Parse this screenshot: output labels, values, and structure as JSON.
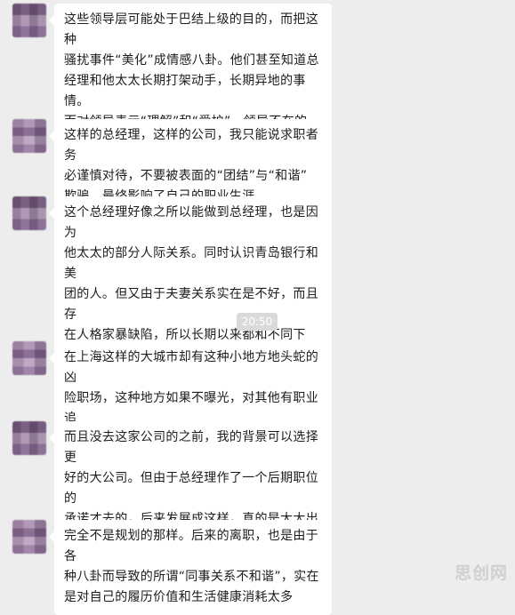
{
  "messages": [
    {
      "avatar_icon": "blurred-avatar-icon",
      "text": "这些领导层可能处于巴结上级的目的，而把这种\n骚扰事件“美化”成情感八卦。他们甚至知道总\n经理和他太太长期打架动手，长期异地的事情。\n而对领导表示“理解”和“爱护”。领导不在的\n时候就是八卦和小鞋的模样了"
    },
    {
      "avatar_icon": "blurred-avatar-icon",
      "text": "这样的总经理，这样的公司，我只能说求职者务\n必谨慎对待，不要被表面的“团结”与“和谐”\n欺骗，最终影响了自己的职业生涯。"
    },
    {
      "avatar_icon": "blurred-avatar-icon",
      "text": "这个总经理好像之所以能做到总经理，也是因为\n他太太的部分人际关系。同时认识青岛银行和美\n团的人。但又由于夫妻关系实在是不好，而且存\n在人格家暴缺陷，所以长期以来都和不同下属“\n暧昧”。"
    },
    {
      "avatar_icon": "blurred-avatar-icon",
      "text": "在上海这样的大城市却有这种小地方地头蛇的凶\n险职场，这种地方如果不曝光，对其他有职业追\n求的求职者非常不利"
    },
    {
      "avatar_icon": "blurred-avatar-icon",
      "text": "而且没去这家公司的之前，我的背景可以选择更\n好的大公司。但由于总经理作了一个后期职位的\n承诺才去的，后来发展成这样，真的是大大出乎\n意料"
    },
    {
      "avatar_icon": "blurred-avatar-icon",
      "text": "完全不是规划的那样。后来的离职，也是由于各\n种八卦而导致的所谓“同事关系不和谐”，实在\n是对自己的履历价值和生活健康消耗太多"
    }
  ],
  "timestamp": "20:50",
  "watermark": "思创网"
}
